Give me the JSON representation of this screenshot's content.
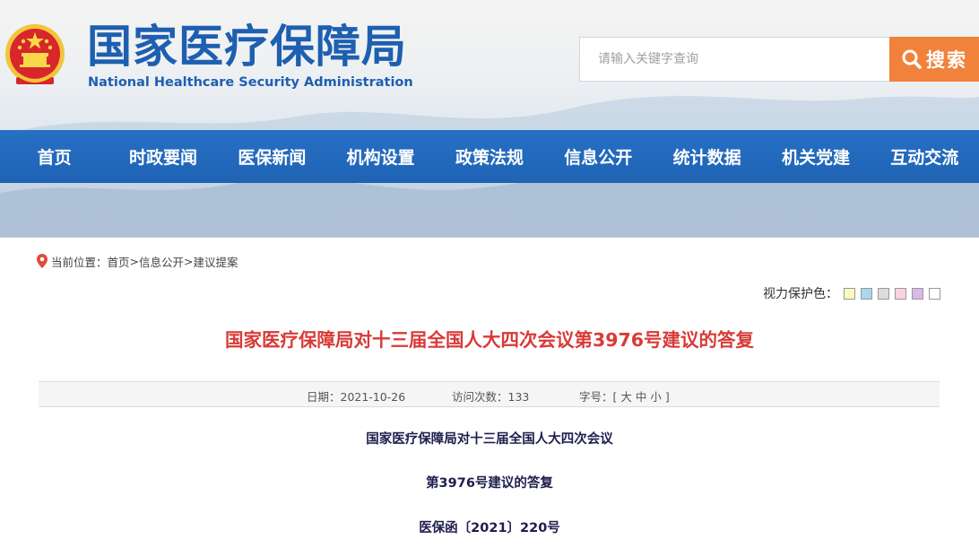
{
  "header": {
    "logo_cn": "国家医疗保障局",
    "logo_en": "National Healthcare Security Administration",
    "search": {
      "placeholder": "请输入关键字查询",
      "button_label": "搜索"
    }
  },
  "nav": {
    "items": [
      "首页",
      "时政要闻",
      "医保新闻",
      "机构设置",
      "政策法规",
      "信息公开",
      "统计数据",
      "机关党建",
      "互动交流"
    ]
  },
  "breadcrumb": {
    "prefix": "当前位置：",
    "items": [
      "首页",
      "信息公开",
      "建议提案"
    ],
    "separator": ">"
  },
  "eye_protection": {
    "label": "视力保护色：",
    "colors": [
      "#fafac0",
      "#a6d8f2",
      "#dcdcdc",
      "#f7d4de",
      "#d9b8ec",
      "#ffffff"
    ]
  },
  "article": {
    "title": "国家医疗保障局对十三届全国人大四次会议第3976号建议的答复",
    "meta": {
      "date_label": "日期：",
      "date": "2021-10-26",
      "visits_label": "访问次数：",
      "visits": "133",
      "font_label": "字号：[",
      "font_sizes": [
        "大",
        "中",
        "小"
      ],
      "font_close": "]"
    },
    "body": [
      "国家医疗保障局对十三届全国人大四次会议",
      "第3976号建议的答复",
      "医保函〔2021〕220号"
    ]
  },
  "colors": {
    "nav_blue": "#2169bd",
    "brand_blue": "#1d5fb0",
    "title_red": "#d83a37",
    "search_orange": "#f0823c"
  }
}
